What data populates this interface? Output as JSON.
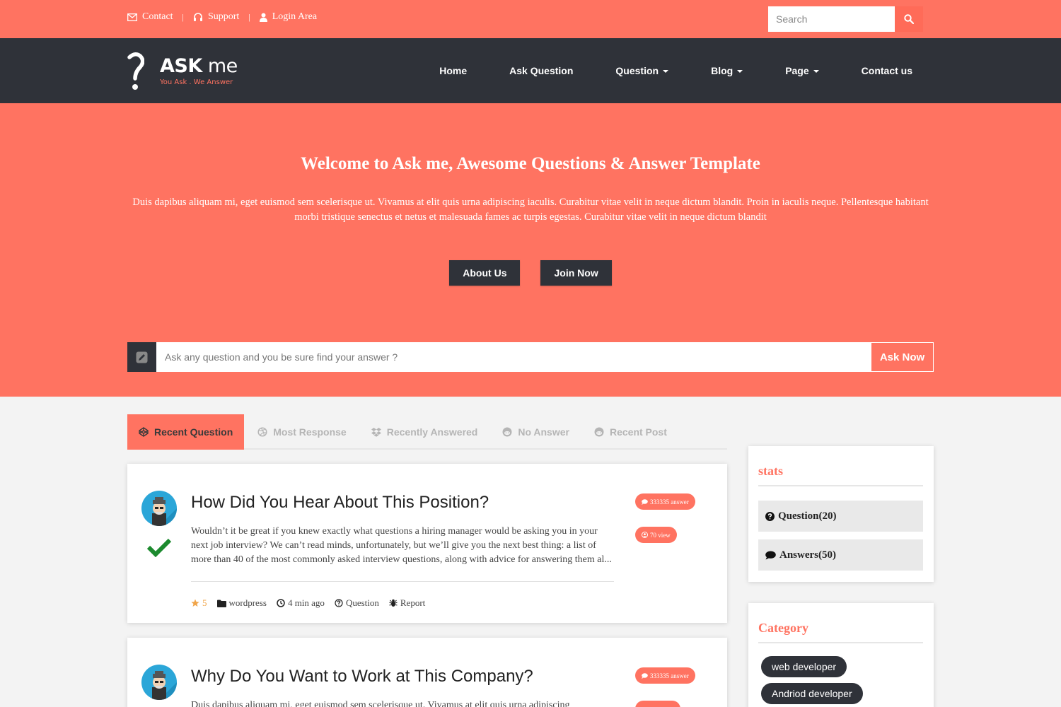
{
  "topbar": {
    "links": [
      {
        "label": "Contact",
        "icon": "envelope-icon"
      },
      {
        "label": "Support",
        "icon": "headset-icon"
      },
      {
        "label": "Login Area",
        "icon": "user-icon"
      }
    ],
    "search_placeholder": "Search"
  },
  "logo": {
    "title_bold": "ASK",
    "title_rest": " me",
    "tagline": "You Ask . We Answer"
  },
  "nav": {
    "items": [
      {
        "label": "Home",
        "dropdown": false
      },
      {
        "label": "Ask Question",
        "dropdown": false
      },
      {
        "label": "Question",
        "dropdown": true
      },
      {
        "label": "Blog",
        "dropdown": true
      },
      {
        "label": "Page",
        "dropdown": true
      },
      {
        "label": "Contact us",
        "dropdown": false
      }
    ]
  },
  "hero": {
    "title": "Welcome to Ask me, Awesome Questions & Answer Template",
    "text": "Duis dapibus aliquam mi, eget euismod sem scelerisque ut. Vivamus at elit quis urna adipiscing iaculis. Curabitur vitae velit in neque dictum blandit. Proin in iaculis neque. Pellentesque habitant morbi tristique senectus et netus et malesuada fames ac turpis egestas. Curabitur vitae velit in neque dictum blandit",
    "buttons": [
      "About Us",
      "Join Now"
    ],
    "ask_placeholder": "Ask any question and you be sure find your answer ?",
    "ask_button": "Ask Now"
  },
  "tabs": [
    {
      "label": "Recent Question",
      "active": true
    },
    {
      "label": "Most Response",
      "active": false
    },
    {
      "label": "Recently Answered",
      "active": false
    },
    {
      "label": "No Answer",
      "active": false
    },
    {
      "label": "Recent Post",
      "active": false
    }
  ],
  "questions": [
    {
      "title": "How Did You Hear About This Position?",
      "text": "Wouldn’t it be great if you knew exactly what questions a hiring manager would be asking you in your next job interview? We can’t read minds, unfortunately, but we’ll give you the next best thing: a list of more than 40 of the most commonly asked interview questions, along with advice for answering them al...",
      "answers": "333335 answer",
      "views": "70 view",
      "rating": "5",
      "category": "wordpress",
      "time": "4 min ago",
      "type": "Question",
      "report": "Report",
      "solved": true
    },
    {
      "title": "Why Do You Want to Work at This Company?",
      "text": "Duis dapibus aliquam mi, eget euismod sem scelerisque ut. Vivamus at elit quis urna adipiscing",
      "answers": "333335 answer"
    }
  ],
  "sidebar": {
    "stats_title": "stats",
    "stats": [
      {
        "label": "Question(20)",
        "icon": "question-circle-icon"
      },
      {
        "label": "Answers(50)",
        "icon": "comment-icon"
      }
    ],
    "category_title": "Category",
    "categories": [
      "web developer",
      "Andriod developer"
    ]
  },
  "colors": {
    "accent": "#ff7361",
    "dark": "#2f3239"
  }
}
